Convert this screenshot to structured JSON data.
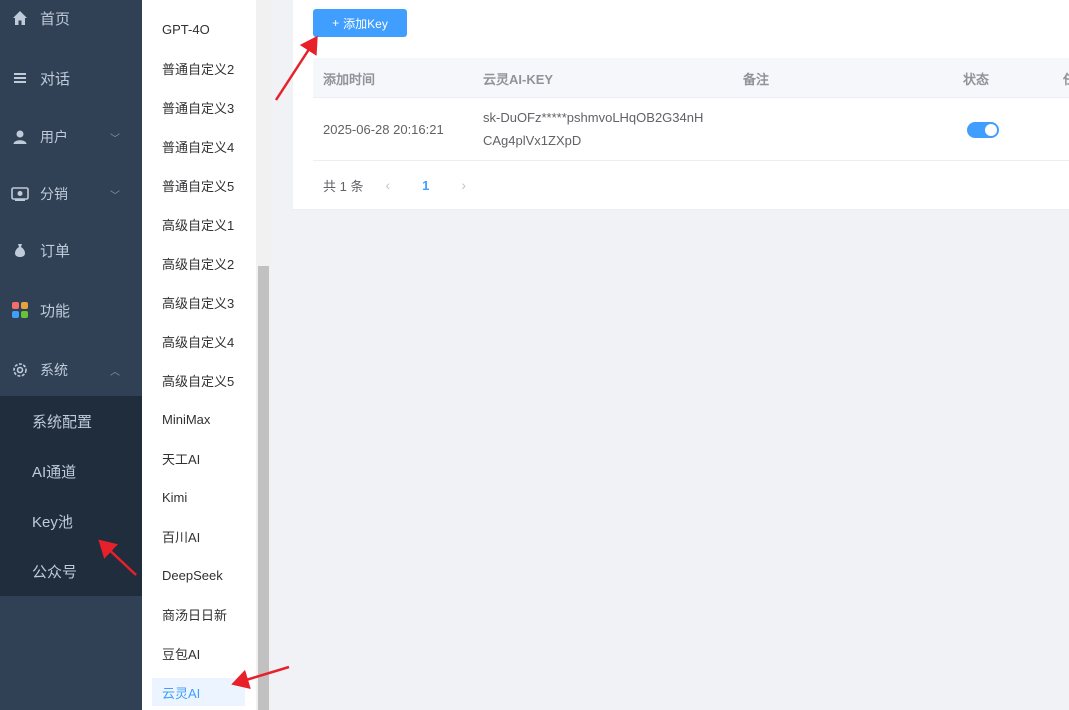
{
  "sidebar": {
    "items": [
      {
        "label": "首页",
        "icon": "home-icon"
      },
      {
        "label": "对话",
        "icon": "list-icon"
      },
      {
        "label": "用户",
        "icon": "user-icon",
        "arrow": "﹀"
      },
      {
        "label": "分销",
        "icon": "share-icon",
        "arrow": "﹀"
      },
      {
        "label": "订单",
        "icon": "money-bag-icon"
      },
      {
        "label": "功能",
        "icon": "apps-icon"
      },
      {
        "label": "系统",
        "icon": "gear-icon",
        "arrow": "︿"
      }
    ],
    "sub_items": [
      "系统配置",
      "AI通道",
      "Key池",
      "公众号"
    ]
  },
  "models": [
    "GPT-4O",
    "普通自定义2",
    "普通自定义3",
    "普通自定义4",
    "普通自定义5",
    "高级自定义1",
    "高级自定义2",
    "高级自定义3",
    "高级自定义4",
    "高级自定义5",
    "MiniMax",
    "天工AI",
    "Kimi",
    "百川AI",
    "DeepSeek",
    "商汤日日新",
    "豆包AI",
    "云灵AI"
  ],
  "toolbar": {
    "add_label": "添加Key",
    "add_icon": "+"
  },
  "table": {
    "headers": [
      "添加时间",
      "云灵AI-KEY",
      "备注",
      "状态",
      "任"
    ],
    "row": {
      "time": "2025-06-28 20:16:21",
      "key_line1": "sk-DuOFz*****pshmvoLHqOB2G34nH",
      "key_line2": "CAg4plVx1ZXpD",
      "note": "",
      "status_on": true
    }
  },
  "pagination": {
    "total": "共 1 条",
    "current": "1",
    "prev": "‹",
    "next": "›"
  },
  "colors": {
    "accent": "#409eff",
    "sidebar": "#304156",
    "arrow": "#e8202a"
  }
}
